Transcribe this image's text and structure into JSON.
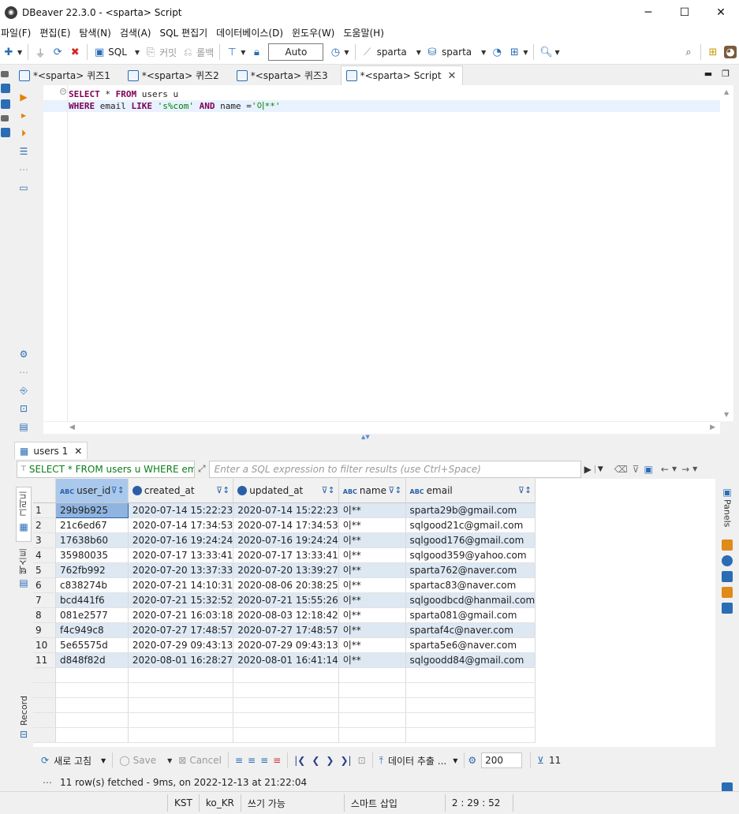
{
  "window": {
    "title": "DBeaver 22.3.0 - <sparta> Script",
    "minimize": "─",
    "maximize": "☐",
    "close": "✕"
  },
  "menu": [
    "파일(F)",
    "편집(E)",
    "탐색(N)",
    "검색(A)",
    "SQL 편집기",
    "데이터베이스(D)",
    "윈도우(W)",
    "도움말(H)"
  ],
  "toolbar": {
    "sql_label": "SQL",
    "commit_label": "커밋",
    "rollback_label": "롤백",
    "transaction_mode": "Auto",
    "connection": "sparta",
    "schema": "sparta"
  },
  "editor_tabs": [
    {
      "label": "*<sparta> 퀴즈1"
    },
    {
      "label": "*<sparta> 퀴즈2"
    },
    {
      "label": "*<sparta> 퀴즈3"
    },
    {
      "label": "*<sparta> Script"
    }
  ],
  "editor": {
    "line1": {
      "kw1": "SELECT",
      "rest1": " * ",
      "kw2": "FROM",
      "rest2": " users u"
    },
    "line2": {
      "kw1": "WHERE",
      "rest1": " email ",
      "kw2": "LIKE",
      "str1": " 's%com' ",
      "kw3": "AND",
      "rest2": " name =",
      "str2": "'이**'"
    }
  },
  "results": {
    "tab_label": "users 1",
    "query_label": "SELECT * FROM users u WHERE email",
    "filter_placeholder": "Enter a SQL expression to filter results (use Ctrl+Space)",
    "side_tabs": {
      "grid": "그리드",
      "text": "텍스트",
      "record": "Record"
    },
    "right_panel_label": "Panels",
    "columns": [
      "user_id",
      "created_at",
      "updated_at",
      "name",
      "email"
    ],
    "column_types": [
      "ABC",
      "clock",
      "clock",
      "ABC",
      "ABC"
    ],
    "rows": [
      [
        "1",
        "29b9b925",
        "2020-07-14 15:22:23",
        "2020-07-14 15:22:23",
        "이**",
        "sparta29b@gmail.com"
      ],
      [
        "2",
        "21c6ed67",
        "2020-07-14 17:34:53",
        "2020-07-14 17:34:53",
        "이**",
        "sqlgood21c@gmail.com"
      ],
      [
        "3",
        "17638b60",
        "2020-07-16 19:24:24",
        "2020-07-16 19:24:24",
        "이**",
        "sqlgood176@gmail.com"
      ],
      [
        "4",
        "35980035",
        "2020-07-17 13:33:41",
        "2020-07-17 13:33:41",
        "이**",
        "sqlgood359@yahoo.com"
      ],
      [
        "5",
        "762fb992",
        "2020-07-20 13:37:33",
        "2020-07-20 13:39:27",
        "이**",
        "sparta762@naver.com"
      ],
      [
        "6",
        "c838274b",
        "2020-07-21 14:10:31",
        "2020-08-06 20:38:25",
        "이**",
        "spartac83@naver.com"
      ],
      [
        "7",
        "bcd441f6",
        "2020-07-21 15:32:52",
        "2020-07-21 15:55:26",
        "이**",
        "sqlgoodbcd@hanmail.com"
      ],
      [
        "8",
        "081e2577",
        "2020-07-21 16:03:18",
        "2020-08-03 12:18:42",
        "이**",
        "sparta081@gmail.com"
      ],
      [
        "9",
        "f4c949c8",
        "2020-07-27 17:48:57",
        "2020-07-27 17:48:57",
        "이**",
        "spartaf4c@naver.com"
      ],
      [
        "10",
        "5e65575d",
        "2020-07-29 09:43:13",
        "2020-07-29 09:43:13",
        "이**",
        "sparta5e6@naver.com"
      ],
      [
        "11",
        "d848f82d",
        "2020-08-01 16:28:27",
        "2020-08-01 16:41:14",
        "이**",
        "sqlgoodd84@gmail.com"
      ]
    ],
    "bottom": {
      "refresh": "새로 고침",
      "save": "Save",
      "cancel": "Cancel",
      "export": "데이터 추출 ...",
      "fetch_size": "200",
      "row_count": "11"
    },
    "fetch_status": "11 row(s) fetched - 9ms, on 2022-12-13 at 21:22:04"
  },
  "statusbar": {
    "timezone": "KST",
    "locale": "ko_KR",
    "mode": "쓰기 가능",
    "insert": "스마트 삽입",
    "position": "2 : 29 : 52"
  }
}
